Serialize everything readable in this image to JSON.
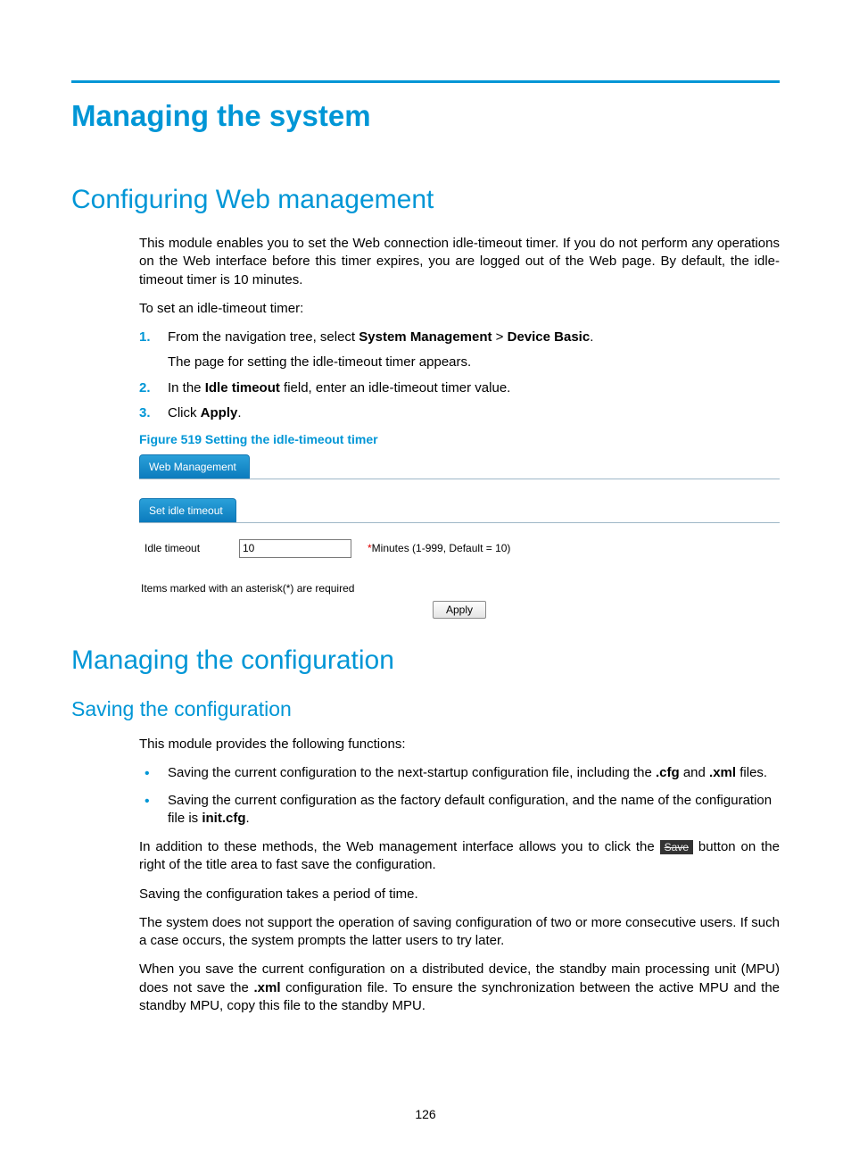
{
  "page_number": "126",
  "h1": "Managing the system",
  "h2a": "Configuring Web management",
  "intro_a": "This module enables you to set the Web connection idle-timeout timer. If you do not perform any operations on the Web interface before this timer expires, you are logged out of the Web page. By default, the idle-timeout timer is 10 minutes.",
  "lead_a": "To set an idle-timeout timer:",
  "steps": {
    "s1": {
      "num": "1.",
      "pre": "From the navigation tree, select ",
      "b1": "System Management",
      "mid": " > ",
      "b2": "Device Basic",
      "post": ".",
      "sub": "The page for setting the idle-timeout timer appears."
    },
    "s2": {
      "num": "2.",
      "pre": "In the ",
      "b1": "Idle timeout",
      "post": " field, enter an idle-timeout timer value."
    },
    "s3": {
      "num": "3.",
      "pre": "Click ",
      "b1": "Apply",
      "post": "."
    }
  },
  "figcap": "Figure 519  Setting the idle-timeout timer",
  "ui": {
    "tab1": "Web Management",
    "tab2": "Set idle timeout",
    "field_label": "Idle timeout",
    "field_value": "10",
    "field_hint": "Minutes (1-999, Default = 10)",
    "req_note": "Items marked with an asterisk(*) are required",
    "apply": "Apply"
  },
  "h2b": "Managing the configuration",
  "h3b": "Saving the configuration",
  "intro_b": "This module provides the following functions:",
  "bullets": {
    "b1": {
      "pre": "Saving the current configuration to the next-startup configuration file, including the ",
      "b1": ".cfg",
      "mid": " and ",
      "b2": ".xml",
      "post": " files."
    },
    "b2": {
      "pre": "Saving the current configuration as the factory default configuration, and the name of the configuration file is ",
      "b1": "init.cfg",
      "post": "."
    }
  },
  "para_c_pre": "In addition to these methods, the Web management interface allows you to click the ",
  "save_chip": "Save",
  "para_c_post": " button on the right of the title area to fast save the configuration.",
  "para_d": "Saving the configuration takes a period of time.",
  "para_e": "The system does not support the operation of saving configuration of two or more consecutive users. If such a case occurs, the system prompts the latter users to try later.",
  "para_f_pre": "When you save the current configuration on a distributed device, the standby main processing unit (MPU) does not save the ",
  "para_f_b": ".xml",
  "para_f_post": " configuration file. To ensure the synchronization between the active MPU and the standby MPU, copy this file to the standby MPU."
}
